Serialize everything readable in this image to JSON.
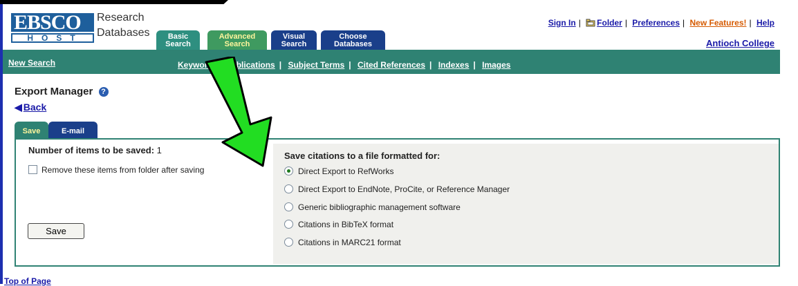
{
  "brand": {
    "logo_top": "EBSCO",
    "logo_bottom": "HOST",
    "line1": "Research",
    "line2": "Databases"
  },
  "tabs": [
    {
      "line1": "Basic",
      "line2": "Search"
    },
    {
      "line1": "Advanced",
      "line2": "Search"
    },
    {
      "line1": "Visual",
      "line2": "Search"
    },
    {
      "line1": "Choose",
      "line2": "Databases"
    }
  ],
  "toplinks": {
    "sign_in": "Sign In",
    "folder": "Folder",
    "preferences": "Preferences",
    "new_features": "New Features!",
    "help": "Help",
    "sep": "|"
  },
  "institution": "Antioch College",
  "subnav": {
    "new_search": "New Search",
    "links": [
      "Keyword",
      "Publications",
      "Subject Terms",
      "Cited References",
      "Indexes",
      "Images"
    ],
    "sep": "|"
  },
  "page": {
    "title": "Export Manager",
    "help_glyph": "?",
    "back": "Back",
    "back_glyph": "◀"
  },
  "export_tabs": {
    "save": "Save",
    "email": "E-mail"
  },
  "left": {
    "num_label": "Number of items to be saved:",
    "num_value": "1",
    "remove_label": "Remove these items from folder after saving",
    "save_button": "Save"
  },
  "right": {
    "heading": "Save citations to a file formatted for:",
    "options": [
      "Direct Export to RefWorks",
      "Direct Export to EndNote, ProCite, or Reference Manager",
      "Generic bibliographic management software",
      "Citations in BibTeX format",
      "Citations in MARC21 format"
    ],
    "selected_option": "Direct Export to RefWorks"
  },
  "footer": {
    "top_of_page": "Top of Page"
  },
  "colors": {
    "subnav": "#2f8273",
    "link": "#1a1aa8",
    "arrow": "#22dd22",
    "accent_hot": "#d65a00"
  },
  "icons": [
    "folder-icon",
    "help-icon",
    "back-triangle-icon",
    "green-arrow-annotation"
  ]
}
